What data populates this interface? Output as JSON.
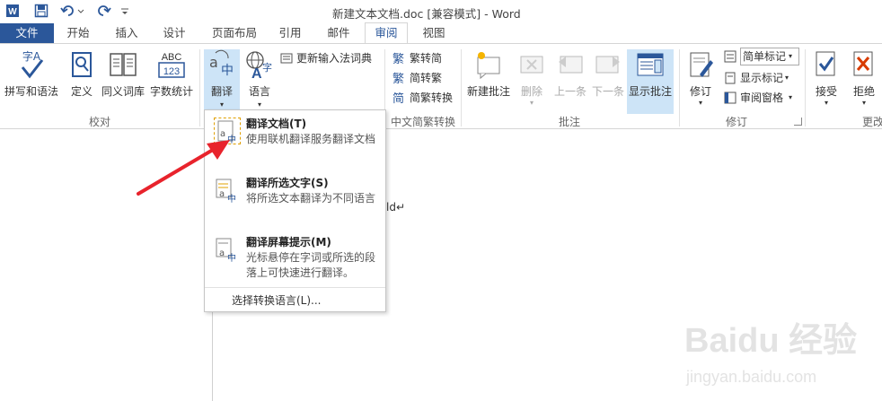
{
  "app": {
    "title": "新建文本文档.doc [兼容模式] - Word"
  },
  "tabs": [
    "文件",
    "开始",
    "插入",
    "设计",
    "页面布局",
    "引用",
    "邮件",
    "审阅",
    "视图"
  ],
  "active_tab": "审阅",
  "ribbon": {
    "proofing": {
      "label": "校对",
      "spell": "拼写和语法",
      "define": "定义",
      "thesaurus": "同义词库",
      "wordcount": "字数统计",
      "abc": "ABC",
      "abc_num": "123"
    },
    "translate_group": {
      "translate": "翻译",
      "language": "语言",
      "update_ime": "更新输入法词典"
    },
    "chinese": {
      "label": "中文简繁转换",
      "t2s": "繁转简",
      "s2t": "简转繁",
      "convert": "简繁转换"
    },
    "comments": {
      "label": "批注",
      "new": "新建批注",
      "delete": "删除",
      "prev": "上一条",
      "next": "下一条",
      "show": "显示批注"
    },
    "tracking": {
      "label": "修订",
      "track": "修订",
      "markup_select": "简单标记",
      "show_markup": "显示标记",
      "pane": "审阅窗格"
    },
    "changes": {
      "label": "更改",
      "accept": "接受",
      "reject": "拒绝"
    }
  },
  "menu": {
    "items": [
      {
        "title": "翻译文档(T)",
        "desc": "使用联机翻译服务翻译文档"
      },
      {
        "title": "翻译所选文字(S)",
        "desc": "将所选文本翻译为不同语言"
      },
      {
        "title": "翻译屏幕提示(M)",
        "desc": "光标悬停在字词或所选的段落上可快速进行翻译。"
      }
    ],
    "choose_language": "选择转换语言(L)..."
  },
  "document": {
    "visible_text": "ld↵"
  },
  "watermark": {
    "brand": "Baidu 经验",
    "url": "jingyan.baidu.com"
  },
  "colors": {
    "accent": "#2b579a",
    "highlight": "#cde4f7",
    "arrow": "#e8232c"
  }
}
